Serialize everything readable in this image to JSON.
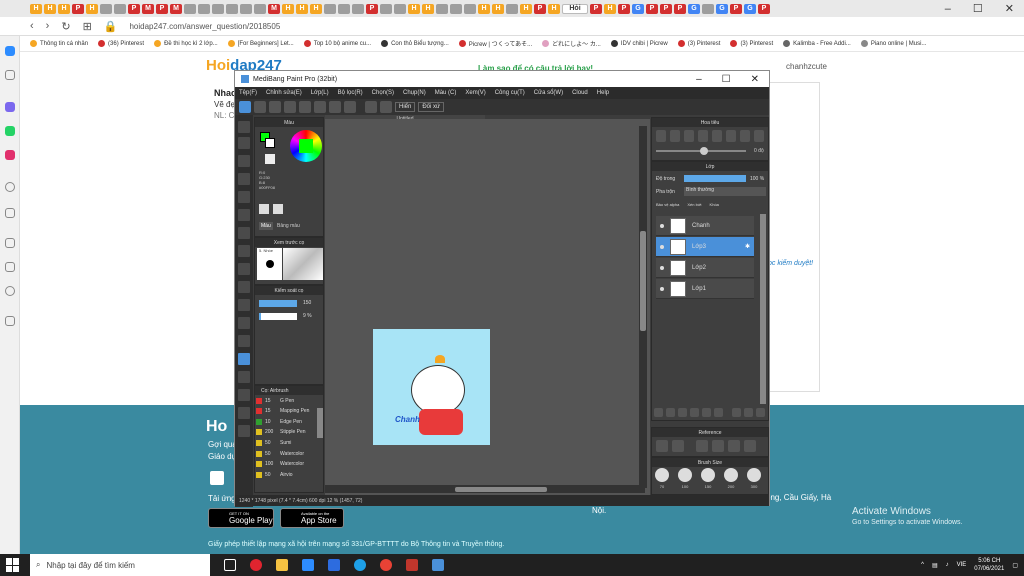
{
  "browser": {
    "url": "hoidap247.com/answer_question/2018505",
    "active_tab": "Hỏi",
    "bookmarks": [
      "Thông tin cá nhân",
      "(36) Pinterest",
      "Đề thi học kì 2 lớp...",
      "[For Beginners] Let...",
      "Top 10 bộ anime cu...",
      "Con thỏ Biểu tượng...",
      "Picrew | つくってあそ...",
      "どれにしよ～ カ...",
      "IDV chibi | Picrew",
      "(3) Pinterest",
      "(3) Pinterest",
      "Kalimba - Free Addi...",
      "Piano online | Musi..."
    ],
    "tabs": [
      "H",
      "H",
      "H",
      "P",
      "H",
      "",
      "",
      "P",
      "M",
      "P",
      "M",
      "",
      "",
      "",
      "",
      "",
      "",
      "M",
      "H",
      "H",
      "H",
      "",
      "",
      "",
      "P",
      "",
      "",
      "H",
      "H",
      "",
      "",
      "",
      "H",
      "H",
      "",
      "H",
      "P",
      "H",
      "Hỏi",
      "P",
      "H",
      "P",
      "G",
      "P",
      "P",
      "P",
      "G",
      "",
      "G",
      "P",
      "G",
      "P"
    ]
  },
  "web": {
    "logo_a": "Hoi",
    "logo_b": "dap247",
    "ask_link": "Làm sao để có câu trả lời hay!",
    "user": "chanhzcute",
    "q_title": "Nhac",
    "q_line": "Vẽ đẹ",
    "q_nl": "NL: C",
    "pending": "ọc kiểm duyệt!",
    "foot_logo_a": "Ho",
    "foot_logo_b": "",
    "foot_gq": "Gợi qua",
    "foot_gd": "Giáo dụ",
    "foot_tai": "Tải ứng",
    "google_small": "GET IT ON",
    "google_big": "Google Play",
    "apple_small": "Available on the",
    "apple_big": "App Store",
    "foot_addr": "ông, Cầu Giấy, Hà",
    "foot_noi": "Nội.",
    "license": "Giấy phép thiết lập mạng xã hội trên mạng số 331/GP-BTTTT do Bộ Thông tin và Truyền thông.",
    "activate_title": "Activate Windows",
    "activate_sub": "Go to Settings to activate Windows."
  },
  "paint": {
    "title": "MediBang Paint Pro (32bit)",
    "menu": [
      "Tệp(F)",
      "Chỉnh sửa(E)",
      "Lớp(L)",
      "Bộ lọc(R)",
      "Chọn(S)",
      "Chụp(N)",
      "Màu (C)",
      "Xem(V)",
      "Công cụ(T)",
      "Cửa sổ(W)",
      "Cloud",
      "Help"
    ],
    "hiển": "Hiển",
    "đối_xứ": "Đối xứ",
    "canvas_tab": "Untitled",
    "status": "1240 * 1748 pixel  (7.4 * 7.4cm)  600 dpi  12 %  (1457, 72)",
    "color_panel": "Màu",
    "color_values": [
      "R:0",
      "G:230",
      "B:8"
    ],
    "hex": "#00FF08",
    "tab_color": "Màu",
    "tab_palette": "Bảng màu",
    "preview_panel": "Xem trước cọ",
    "brush_name": "5. Nhòe",
    "brush_ctrl": "Kiểm soát cọ",
    "size_val": "150",
    "opacity_val": "9 %",
    "brush_list_title": "Cọ: Airbrush",
    "brushes": [
      {
        "size": "15",
        "name": "G Pen",
        "color": "#e03030"
      },
      {
        "size": "15",
        "name": "Mapping Pen",
        "color": "#e03030"
      },
      {
        "size": "10",
        "name": "Edge Pen",
        "color": "#30a030"
      },
      {
        "size": "200",
        "name": "Stipple Pen",
        "color": "#e0c020"
      },
      {
        "size": "50",
        "name": "Sumi",
        "color": "#e0c020"
      },
      {
        "size": "50",
        "name": "Watercolor",
        "color": "#e0c020"
      },
      {
        "size": "100",
        "name": "Watercolor",
        "color": "#e0c020"
      },
      {
        "size": "50",
        "name": "Airvio",
        "color": "#e0c020"
      }
    ],
    "nav_panel": "Hoa tiêu",
    "zoom_val": "0 độ",
    "layer_panel": "Lớp",
    "opacity_label": "Độ trong",
    "opacity_pct": "100 %",
    "blend_label": "Pha trộn",
    "blend_val": "Bình thường",
    "protect": "Bảo vệ alpha",
    "clip": "Xén bớt",
    "lock": "Khóa",
    "layers": [
      "Chanh",
      "Lớp3",
      "Lớp2",
      "Lớp1"
    ],
    "reference": "Reference",
    "brush_size_panel": "Brush Size",
    "brush_sizes": [
      "70",
      "100",
      "150",
      "200",
      "300"
    ],
    "art_text": "Chanh"
  },
  "taskbar": {
    "search_placeholder": "Nhập tại đây để tìm kiếm",
    "time": "5:06 CH",
    "date": "07/06/2021",
    "lang": "VIE"
  }
}
